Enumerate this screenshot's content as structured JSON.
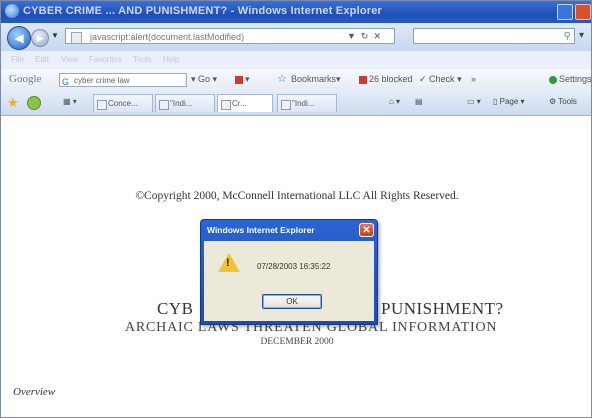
{
  "window": {
    "title": "CYBER CRIME ... AND PUNISHMENT? - Windows Internet Explorer"
  },
  "addressbar": {
    "url": "javascript:alert(document.lastModified)",
    "search_placeholder": ""
  },
  "menu": {
    "items": [
      "File",
      "Edit",
      "View",
      "Favorites",
      "Tools",
      "Help"
    ]
  },
  "google_toolbar": {
    "logo": "Google",
    "search_value": "cyber crime law",
    "go_label": "Go",
    "bookmarks_label": "Bookmarks",
    "blocked_label": "26 blocked",
    "check_label": "Check",
    "more_label": "»",
    "settings_label": "Settings"
  },
  "tabs": [
    {
      "label": "Conce..."
    },
    {
      "label": "\"Indi..."
    },
    {
      "label": "Cr..."
    },
    {
      "label": "\"Indi..."
    }
  ],
  "tab_tools": {
    "page_label": "Page",
    "tools_label": "Tools"
  },
  "content": {
    "copyright": "©Copyright 2000, McConnell International LLC   All Rights Reserved.",
    "heading_left": "CYB",
    "heading_right": "PUNISHMENT?",
    "subheading": "ARCHAIC LAWS THREATEN GLOBAL INFORMATION",
    "date": "DECEMBER 2000",
    "overview": "Overview"
  },
  "dialog": {
    "title": "Windows Internet Explorer",
    "message": "07/28/2003 16:35:22",
    "ok_label": "OK"
  }
}
